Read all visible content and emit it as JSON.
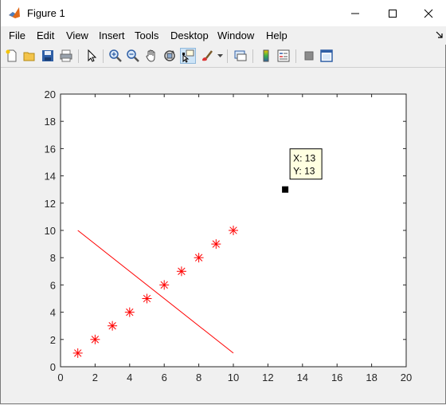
{
  "window": {
    "title": "Figure 1",
    "controls": [
      "minimize-icon",
      "maximize-icon",
      "close-icon"
    ]
  },
  "menu": [
    {
      "id": "file",
      "label": "File"
    },
    {
      "id": "edit",
      "label": "Edit"
    },
    {
      "id": "view",
      "label": "View"
    },
    {
      "id": "insert",
      "label": "Insert"
    },
    {
      "id": "tools",
      "label": "Tools"
    },
    {
      "id": "desktop",
      "label": "Desktop"
    },
    {
      "id": "window",
      "label": "Window"
    },
    {
      "id": "help",
      "label": "Help"
    }
  ],
  "toolbar": {
    "buttons": [
      "new-figure",
      "open-file",
      "save",
      "print",
      "edit-plot-pointer",
      "zoom-in",
      "zoom-out",
      "pan",
      "rotate-3d",
      "data-cursor",
      "brush",
      "link-plot",
      "colorbar",
      "legend",
      "hide-plot-tools",
      "show-plot-tools"
    ],
    "active": "data-cursor"
  },
  "datatip": {
    "x_text": "X: 13",
    "y_text": "Y: 13"
  },
  "chart_data": {
    "type": "line",
    "xlim": [
      0,
      20
    ],
    "ylim": [
      0,
      20
    ],
    "xticks": [
      0,
      2,
      4,
      6,
      8,
      10,
      12,
      14,
      16,
      18,
      20
    ],
    "yticks": [
      0,
      2,
      4,
      6,
      8,
      10,
      12,
      14,
      16,
      18,
      20
    ],
    "grid": false,
    "series": [
      {
        "marker": "asterisk",
        "color": "#ff0000",
        "x": [
          1,
          2,
          3,
          4,
          5,
          6,
          7,
          8,
          9,
          10
        ],
        "y": [
          1,
          2,
          3,
          4,
          5,
          6,
          7,
          8,
          9,
          10
        ]
      },
      {
        "line": "solid",
        "color": "#ff0000",
        "x": [
          1,
          10
        ],
        "y": [
          10,
          1
        ]
      },
      {
        "marker": "square",
        "color": "#000000",
        "x": [
          13
        ],
        "y": [
          13
        ]
      }
    ]
  }
}
